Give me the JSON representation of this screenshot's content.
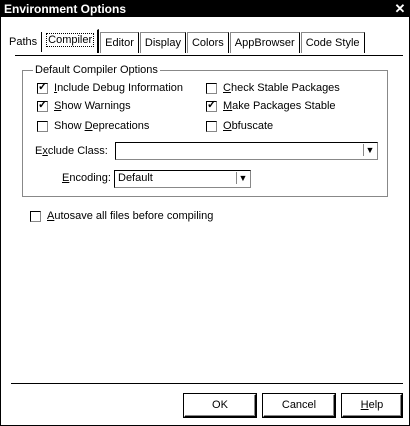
{
  "window": {
    "title": "Environment Options",
    "close_glyph": "✕"
  },
  "tabs": [
    {
      "label": "Paths"
    },
    {
      "label": "Compiler"
    },
    {
      "label": "Editor"
    },
    {
      "label": "Display"
    },
    {
      "label": "Colors"
    },
    {
      "label": "AppBrowser"
    },
    {
      "label": "Code Style"
    }
  ],
  "selected_tab": "Compiler",
  "compiler": {
    "group_label": "Default Compiler Options",
    "options": {
      "include_debug": {
        "pre": "",
        "u": "I",
        "post": "nclude Debug Information",
        "checked": true
      },
      "show_warnings": {
        "pre": "",
        "u": "S",
        "post": "how Warnings",
        "checked": true
      },
      "show_deprecations": {
        "pre": "Show ",
        "u": "D",
        "post": "eprecations",
        "checked": false
      },
      "check_stable": {
        "pre": "",
        "u": "C",
        "post": "heck Stable Packages",
        "checked": false
      },
      "make_stable": {
        "pre": "",
        "u": "M",
        "post": "ake Packages Stable",
        "checked": true
      },
      "obfuscate": {
        "pre": "",
        "u": "O",
        "post": "bfuscate",
        "checked": false
      }
    },
    "exclude_class": {
      "pre": "E",
      "u": "x",
      "post": "clude Class:",
      "value": ""
    },
    "encoding": {
      "pre": "",
      "u": "E",
      "post": "ncoding:",
      "value": "Default"
    },
    "autosave": {
      "pre": "",
      "u": "A",
      "post": "utosave all files before compiling",
      "checked": false
    }
  },
  "buttons": {
    "ok": "OK",
    "cancel": "Cancel",
    "help_u": "H",
    "help_post": "elp"
  },
  "check_glyph": "✓",
  "dropdown_glyph": "▼"
}
